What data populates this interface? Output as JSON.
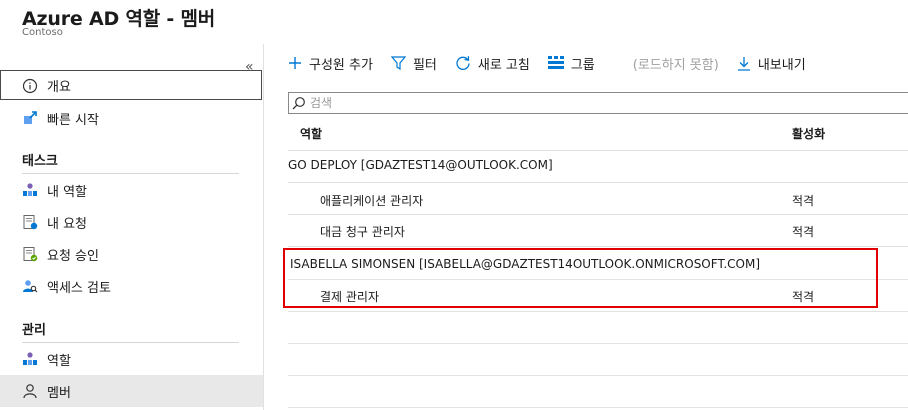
{
  "header": {
    "title": "Azure AD 역할 - 멤버",
    "subtitle": "Contoso"
  },
  "sidebar": {
    "overview": "개요",
    "quickstart": "빠른 시작",
    "tasks_section": "태스크",
    "tasks": [
      "내 역할",
      "내 요청",
      "요청 승인",
      "액세스 검토"
    ],
    "manage_section": "관리",
    "manage": [
      "역할",
      "멤버"
    ],
    "collapse": "«"
  },
  "toolbar": {
    "add_member": "구성원 추가",
    "filter": "필터",
    "refresh": "새로 고침",
    "group": "그룹",
    "loading": "(로드하지 못함)",
    "export": "내보내기"
  },
  "search": {
    "placeholder": "검색"
  },
  "table": {
    "headers": {
      "role": "역할",
      "activation": "활성화"
    },
    "groups": [
      {
        "name": "GO DEPLOY [GDAZTEST14@OUTLOOK.COM]",
        "rows": [
          {
            "role": "애플리케이션 관리자",
            "activation": "적격"
          },
          {
            "role": "대금 청구 관리자",
            "activation": "적격"
          }
        ]
      },
      {
        "name": "ISABELLA SIMONSEN [ISABELLA@GDAZTEST14OUTLOOK.ONMICROSOFT.COM]",
        "rows": [
          {
            "role": "결제 관리자",
            "activation": "적격"
          }
        ]
      }
    ]
  },
  "colors": {
    "accent": "#0078d4",
    "highlight": "#e00000"
  }
}
